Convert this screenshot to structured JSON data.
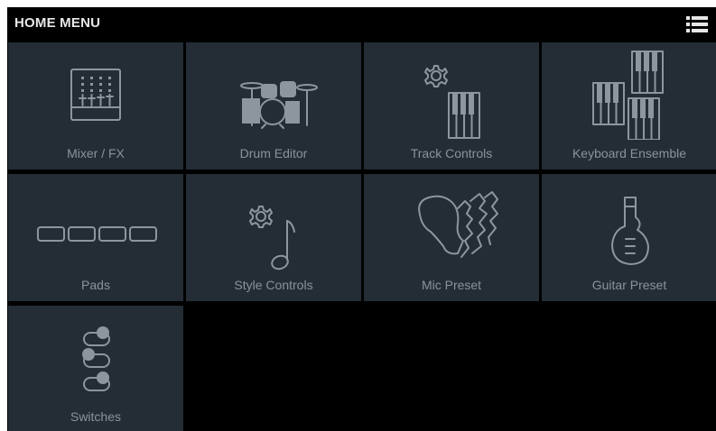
{
  "header": {
    "title": "HOME MENU",
    "menu_icon": "list-menu-icon"
  },
  "tiles": [
    {
      "label": "Mixer / FX",
      "icon": "mixer-icon"
    },
    {
      "label": "Drum Editor",
      "icon": "drum-kit-icon"
    },
    {
      "label": "Track Controls",
      "icon": "track-controls-icon"
    },
    {
      "label": "Keyboard Ensemble",
      "icon": "keyboard-ensemble-icon"
    },
    {
      "label": "Pads",
      "icon": "pads-icon"
    },
    {
      "label": "Style Controls",
      "icon": "style-controls-icon"
    },
    {
      "label": "Mic Preset",
      "icon": "mic-preset-icon"
    },
    {
      "label": "Guitar Preset",
      "icon": "guitar-icon"
    },
    {
      "label": "Switches",
      "icon": "switches-icon"
    }
  ],
  "colors": {
    "background": "#000000",
    "tile": "#242c35",
    "label": "#8a939d",
    "icon": "#8d959e"
  }
}
